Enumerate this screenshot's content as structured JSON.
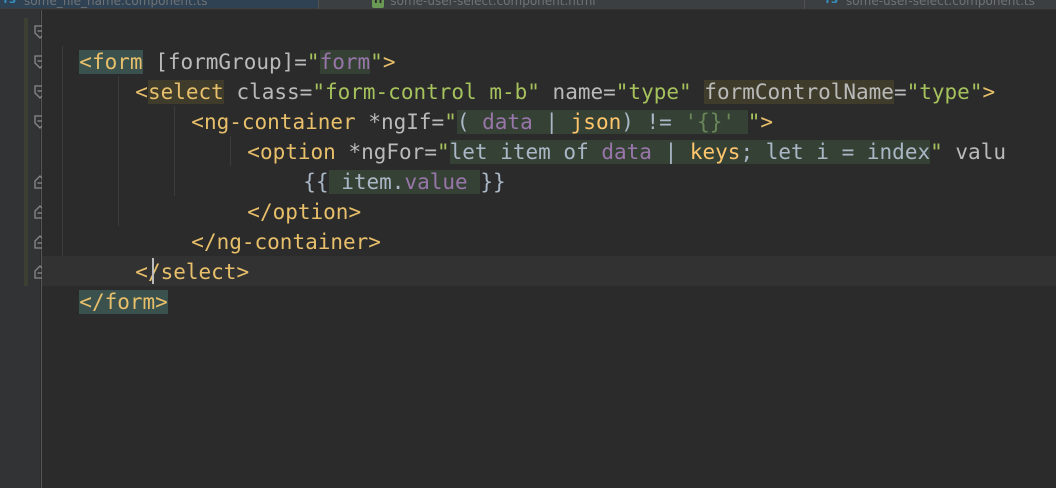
{
  "tabs": [
    {
      "icon": "TS",
      "label": "some_file_name.component.ts",
      "active": true
    },
    {
      "icon": "H",
      "label": "some-user-select.component.html",
      "active": false
    },
    {
      "icon": "TS",
      "label": "some-user-select.component.ts",
      "active": false
    }
  ],
  "code": {
    "line1": {
      "open": "<",
      "tag": "form",
      "sp": " ",
      "attr": "[formGroup]",
      "eq": "=",
      "q1": "\"",
      "val": "form",
      "q2": "\"",
      "close": ">"
    },
    "line2": {
      "open": "<",
      "tag": "select",
      "a1": " class",
      "eq1": "=",
      "v1": "\"form-control m-b\"",
      "a2": " name",
      "eq2": "=",
      "v2": "\"type\"",
      "sp": " ",
      "a3": "formControlName",
      "eq3": "=",
      "v3": "\"type\"",
      "close": ">"
    },
    "line3": {
      "open": "<",
      "tag": "ng-container",
      "a1": " *ngIf",
      "eq": "=",
      "q1": "\"",
      "p1": "( ",
      "v1": "data",
      "p2": " | ",
      "fn": "json",
      "p3": ") != ",
      "s1": "'{}'",
      "p4": " ",
      "q2": "\"",
      "close": ">"
    },
    "line4": {
      "open": "<",
      "tag": "option",
      "a1": " *ngFor",
      "eq": "=",
      "q1": "\"",
      "p1": "let item of ",
      "v1": "data",
      "p2": " | ",
      "fn": "keys",
      "p3": "; let i = index",
      "q2": "\"",
      "a2": " valu"
    },
    "line5": {
      "b1": "{{",
      "p1": " item.",
      "v1": "value",
      "p2": " ",
      "b2": "}}"
    },
    "line6": {
      "text": "</option>"
    },
    "line7": {
      "text": "</ng-container>"
    },
    "line8": {
      "text": "</select>"
    },
    "line9": {
      "text": "</form>"
    }
  },
  "colors": {
    "background": "#2b2b2b",
    "gutter": "#313335",
    "tag": "#e8bf6a",
    "string": "#a5c25c",
    "variable": "#9876aa",
    "function": "#ffc66d"
  }
}
